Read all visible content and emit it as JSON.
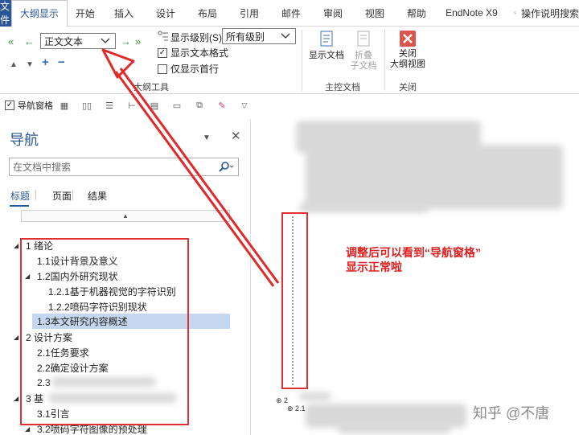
{
  "menubar": {
    "tabs": [
      {
        "label": "文件"
      },
      {
        "label": "大纲显示"
      },
      {
        "label": "开始"
      },
      {
        "label": "插入"
      },
      {
        "label": "设计"
      },
      {
        "label": "布局"
      },
      {
        "label": "引用"
      },
      {
        "label": "邮件"
      },
      {
        "label": "审阅"
      },
      {
        "label": "视图"
      },
      {
        "label": "帮助"
      },
      {
        "label": "EndNote X9"
      }
    ],
    "tell_me": "操作说明搜索"
  },
  "ribbon": {
    "outline_tools": {
      "level_style": "正文文本",
      "show_level_label": "显示级别(S):",
      "show_level_value": "所有级别",
      "show_text_format_label": "显示文本格式",
      "show_text_format_checked": true,
      "first_line_only_label": "仅显示首行",
      "first_line_only_checked": false,
      "group_label": "大纲工具"
    },
    "master_doc": {
      "show_doc_label": "显示文档",
      "collapse_line1": "折叠",
      "collapse_line2": "子文档",
      "group_label": "主控文档"
    },
    "close": {
      "close_line1": "关闭",
      "close_line2": "大纲视图",
      "group_label": "关闭"
    }
  },
  "quicktoolbar": {
    "nav_pane_label": "导航窗格",
    "nav_pane_checked": true
  },
  "nav": {
    "title": "导航",
    "search_placeholder": "在文档中搜索",
    "tabs": [
      {
        "label": "标题"
      },
      {
        "label": "页面"
      },
      {
        "label": "结果"
      }
    ],
    "tree": [
      {
        "label": "1 绪论"
      },
      {
        "label": "1.1设计背景及意义"
      },
      {
        "label": "1.2国内外研究现状"
      },
      {
        "label": "1.2.1基于机器视觉的字符识别"
      },
      {
        "label": "1.2.2喷码字符识别现状"
      },
      {
        "label": "1.3本文研究内容概述"
      },
      {
        "label": "2 设计方案"
      },
      {
        "label": "2.1任务要求"
      },
      {
        "label": "2.2确定设计方案"
      },
      {
        "label": "2.3"
      },
      {
        "label": "3 基"
      },
      {
        "label": "3.1引言"
      },
      {
        "label": "3.2喷码字符图像的预处理"
      }
    ]
  },
  "doc": {
    "annotation_line1": "调整后可以看到“导航窗格”",
    "annotation_line2": "显示正常啦",
    "heading_marker_1": "⊕ 2",
    "heading_marker_2": "⊕ 2.1",
    "watermark": "知乎 @不唐"
  },
  "colors": {
    "accent": "#2b579a",
    "highlight_red": "#e03030",
    "close_red": "#d9534f"
  }
}
